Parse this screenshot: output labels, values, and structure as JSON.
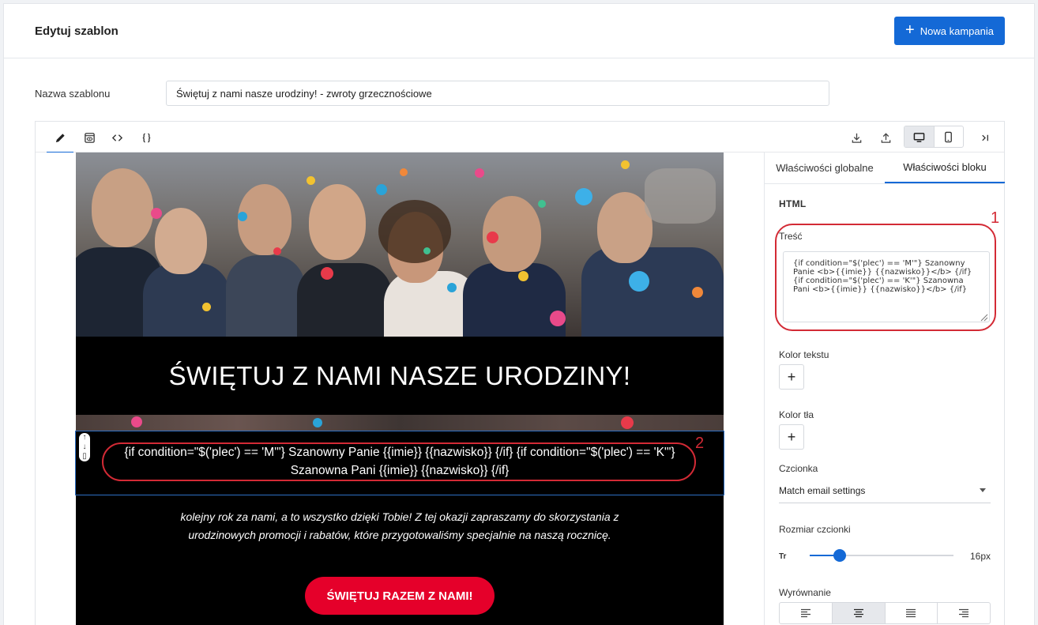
{
  "header": {
    "title": "Edytuj szablon",
    "new_campaign_label": "Nowa kampania",
    "new_campaign_icon": "plus-icon"
  },
  "template_name": {
    "label": "Nazwa szablonu",
    "value": "Świętuj z nami nasze urodziny! - zwroty grzecznościowe"
  },
  "toolbar": {
    "left_tools": [
      "pencil-icon",
      "preview-icon",
      "code-icon",
      "braces-icon"
    ],
    "right_tools": [
      "download-icon",
      "upload-icon",
      "desktop-icon",
      "mobile-icon",
      "collapse-panel-icon"
    ],
    "selected_device": "desktop"
  },
  "email": {
    "headline": "ŚWIĘTUJ Z NAMI NASZE URODZINY!",
    "greeting_block": "{if condition=\"$('plec') == 'M'\"} Szanowny Panie {{imie}} {{nazwisko}} {/if} {if condition=\"$('plec') == 'K'\"} Szanowna Pani {{imie}} {{nazwisko}} {/if}",
    "body_text": "kolejny rok za nami, a to wszystko dzięki Tobie! Z tej okazji zapraszamy do skorzystania z urodzinowych promocji i rabatów, które przygotowaliśmy specjalnie na naszą rocznicę.",
    "cta_label": "ŚWIĘTUJ RAZEM Z NAMI!",
    "cta_color": "#e5002a",
    "annotation_number": "2"
  },
  "panel": {
    "tabs": [
      {
        "label": "Właściwości globalne",
        "active": false
      },
      {
        "label": "Właściwości bloku",
        "active": true
      }
    ],
    "section_title": "HTML",
    "content_label": "Treść",
    "content_value": "{if condition=\"$('plec') == 'M'\"} Szanowny Panie <b>{{imie}} {{nazwisko}}</b> {/if}\n{if condition=\"$('plec') == 'K'\"} Szanowna Pani <b>{{imie}} {{nazwisko}}</b> {/if}",
    "annotation_number": "1",
    "text_color_label": "Kolor tekstu",
    "bg_color_label": "Kolor tła",
    "font_label": "Czcionka",
    "font_value": "Match email settings",
    "font_size_label": "Rozmiar czcionki",
    "font_size_value": "16px",
    "font_size_fraction": 0.21,
    "align_label": "Wyrównanie",
    "align_options": [
      "align-left-icon",
      "align-center-icon",
      "align-justify-icon",
      "align-right-icon"
    ],
    "align_selected": "align-center-icon"
  },
  "colors": {
    "accent": "#1469d6",
    "annotation": "#d32a35"
  }
}
